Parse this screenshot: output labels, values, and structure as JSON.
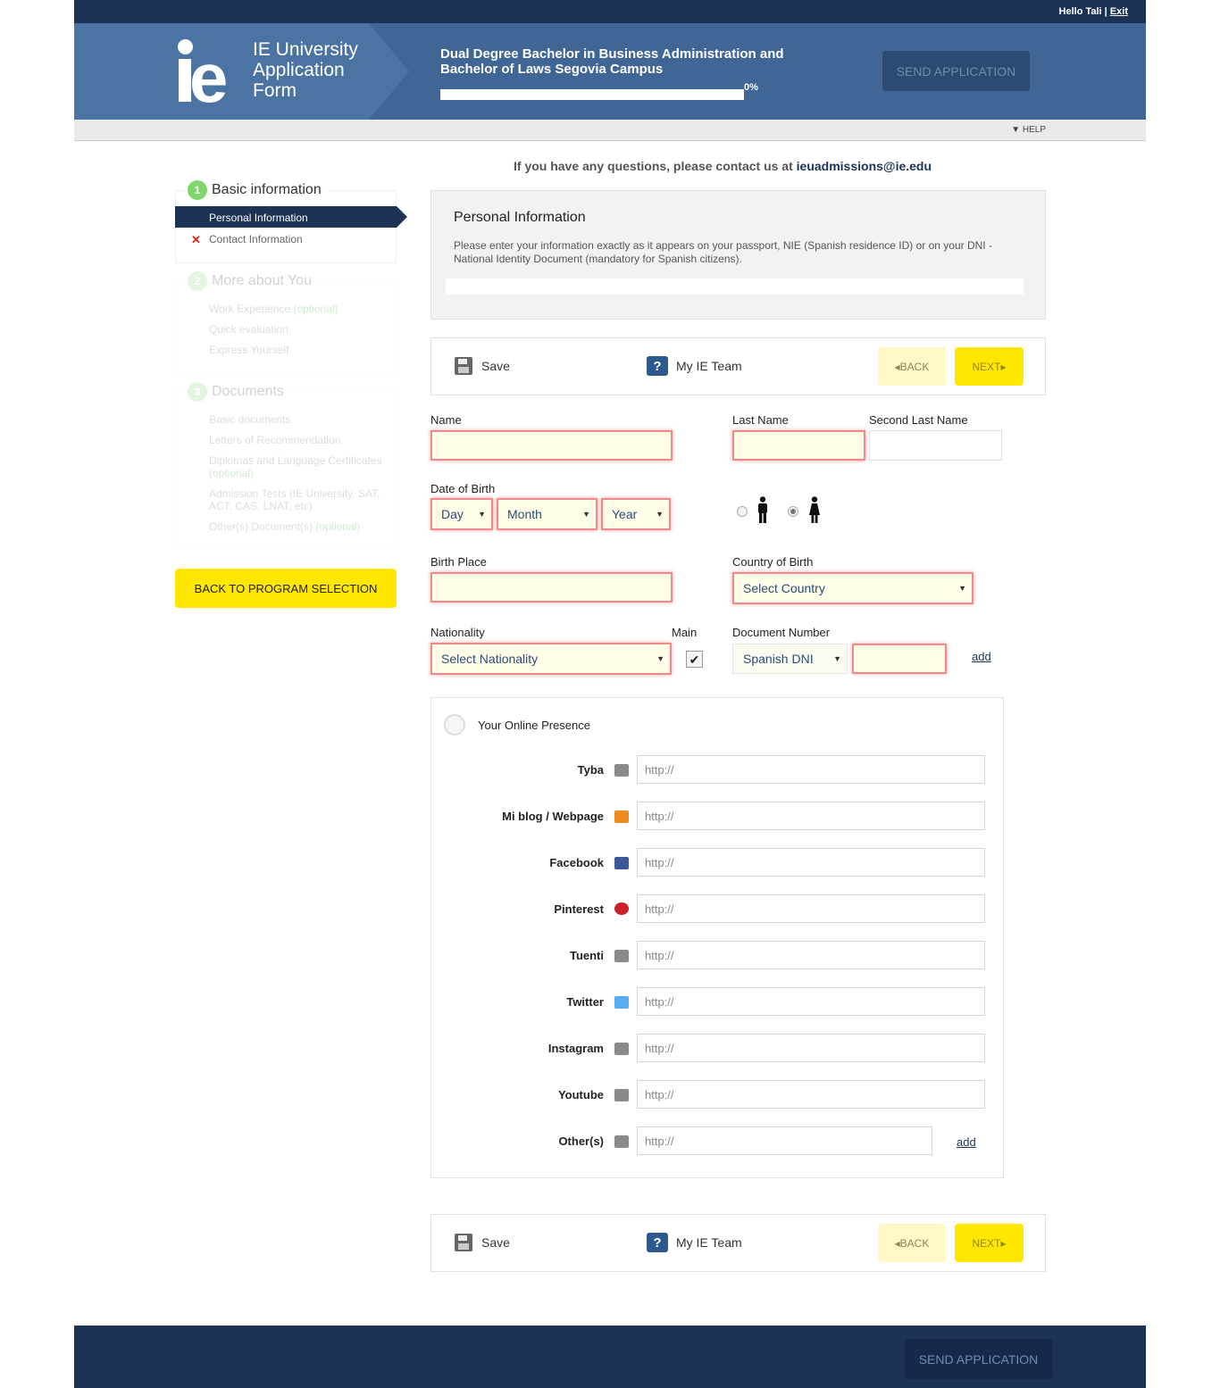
{
  "header": {
    "hello": "Hello Tali |",
    "exit": "Exit",
    "app_title_line1": "IE University",
    "app_title_line2": "Application",
    "app_title_line3": "Form",
    "program_line1": "Dual Degree Bachelor in Business Administration and",
    "program_line2": "Bachelor of Laws Segovia Campus",
    "progress_label": "0%",
    "progress_value": 0,
    "send_application": "SEND APPLICATION",
    "help": "HELP"
  },
  "sidebar": {
    "step1": {
      "number": "1",
      "title": "Basic information",
      "items": [
        "Personal Information",
        "Contact Information"
      ]
    },
    "step2": {
      "number": "2",
      "title": "More about You",
      "items": [
        "Work Experience",
        "Quick evaluation",
        "Express Yourself"
      ],
      "optional": "(optional)"
    },
    "step3": {
      "number": "3",
      "title": "Documents",
      "items": [
        "Basic documents",
        "Letters of Recommendation",
        "Diplomas and Language Certificates",
        "Admission Tests (IE University, SAT, ACT, CAS, LNAT, etc)",
        "Other(s) Document(s)"
      ],
      "optional": "(optional)"
    },
    "back_button": "BACK TO PROGRAM SELECTION"
  },
  "contact": {
    "prefix": "If you have any questions, please contact us at",
    "email": "ieuadmissions@ie.edu"
  },
  "info": {
    "title": "Personal Information",
    "text": "Please enter your information exactly as it appears on your passport, NIE (Spanish residence ID) or on your DNI - National Identity Document (mandatory for Spanish citizens)."
  },
  "toolbar": {
    "save": "Save",
    "team": "My IE Team",
    "back": "BACK",
    "next": "NEXT"
  },
  "form": {
    "name_label": "Name",
    "last_name_label": "Last Name",
    "second_last_name_label": "Second Last Name",
    "dob_label": "Date of Birth",
    "day": "Day",
    "month": "Month",
    "year": "Year",
    "gender_selected": "female",
    "birth_place_label": "Birth Place",
    "country_birth_label": "Country of Birth",
    "country_select": "Select Country",
    "nationality_label": "Nationality",
    "main_label": "Main",
    "main_checked": true,
    "nationality_select": "Select Nationality",
    "doc_number_label": "Document Number",
    "doc_type": "Spanish DNI",
    "add": "add"
  },
  "online": {
    "title": "Your Online Presence",
    "placeholder": "http://",
    "add": "add",
    "networks": [
      "Tyba",
      "Mi blog / Webpage",
      "Facebook",
      "Pinterest",
      "Tuenti",
      "Twitter",
      "Instagram",
      "Youtube",
      "Other(s)"
    ]
  },
  "colors": {
    "navy": "#1c3355",
    "banner": "#3f6694",
    "yellow": "#ffe700",
    "error": "#f08a8a",
    "green": "#7fd66c"
  }
}
